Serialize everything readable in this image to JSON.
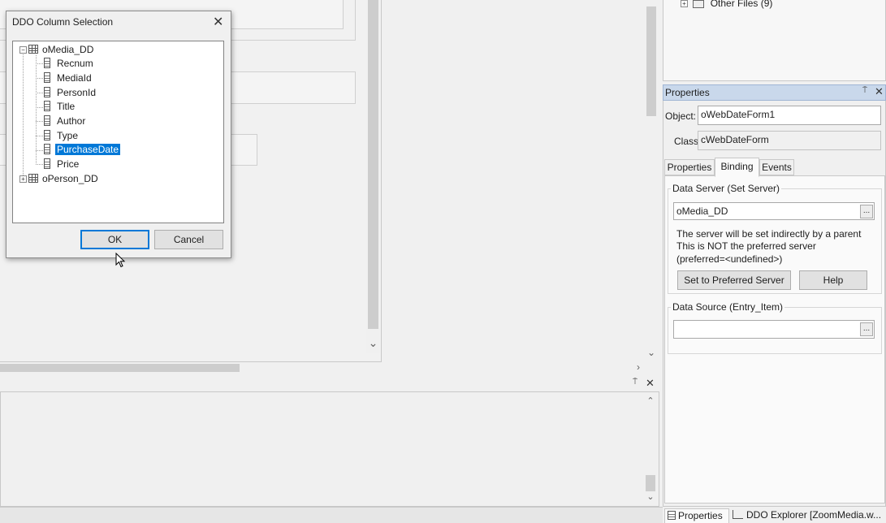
{
  "workspace": {
    "other_files_label": "Other Files (9)"
  },
  "properties_panel": {
    "title": "Properties",
    "object_label": "Object:",
    "object_value": "oWebDateForm1",
    "class_label": "Class",
    "class_value": "cWebDateForm",
    "tabs": [
      {
        "label": "Properties",
        "active": false
      },
      {
        "label": "Binding",
        "active": true
      },
      {
        "label": "Events",
        "active": false
      }
    ],
    "data_server": {
      "group_title": "Data Server (Set Server)",
      "value": "oMedia_DD",
      "browse_label": "...",
      "note_lines": [
        "The server will be set indirectly by a parent",
        "This is NOT the preferred server",
        "(preferred=<undefined>)"
      ],
      "set_preferred_label": "Set to Preferred Server",
      "help_label": "Help"
    },
    "data_source": {
      "group_title": "Data Source (Entry_Item)",
      "value": "",
      "browse_label": "..."
    }
  },
  "bottom_tabs": {
    "properties_label": "Properties",
    "ddo_explorer_label": "DDO Explorer [ZoomMedia.w..."
  },
  "dialog": {
    "title": "DDO Column Selection",
    "tree": [
      {
        "label": "oMedia_DD",
        "type": "table",
        "expander": "−",
        "children": [
          {
            "label": "Recnum",
            "selected": false
          },
          {
            "label": "MediaId",
            "selected": false
          },
          {
            "label": "PersonId",
            "selected": false
          },
          {
            "label": "Title",
            "selected": false
          },
          {
            "label": "Author",
            "selected": false
          },
          {
            "label": "Type",
            "selected": false
          },
          {
            "label": "PurchaseDate",
            "selected": true
          },
          {
            "label": "Price",
            "selected": false
          }
        ]
      },
      {
        "label": "oPerson_DD",
        "type": "table",
        "expander": "+",
        "children": []
      }
    ],
    "ok_label": "OK",
    "cancel_label": "Cancel"
  },
  "colors": {
    "selection": "#0078d7",
    "panel_title_bg": "#c9d8eb",
    "window_bg": "#f0f0f0"
  },
  "icons": {
    "close": "close-icon",
    "pin": "pin-icon",
    "table": "table-icon",
    "field": "field-icon"
  }
}
